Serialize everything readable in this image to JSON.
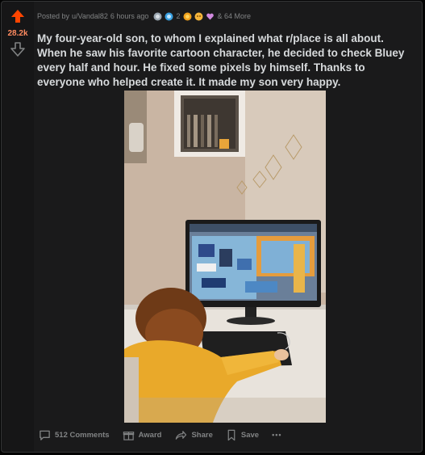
{
  "post": {
    "score": "28.2k",
    "posted_by_prefix": "Posted by",
    "author": "u/Vandal82",
    "time": "6 hours ago",
    "award_count": "2",
    "more_awards": "& 64 More",
    "title": "My four-year-old son, to whom I explained what r/place is all about. When he saw his favorite cartoon character, he decided to check Bluey every half and hour. He fixed some pixels by himself. Thanks to everyone who helped create it. It made my son very happy."
  },
  "actions": {
    "comments": "512 Comments",
    "award": "Award",
    "share": "Share",
    "save": "Save",
    "more": "•••"
  },
  "icons": {
    "upvote": "upvote-arrow-icon",
    "downvote": "downvote-arrow-icon",
    "comments": "comment-bubble-icon",
    "award": "gift-icon",
    "share": "share-arrow-icon",
    "save": "bookmark-icon",
    "more": "ellipsis-icon"
  },
  "colors": {
    "upvoted": "#ff4500",
    "score": "#ff8b60",
    "text": "#d7dadc",
    "muted": "#818384",
    "card_bg": "#1a1a1b"
  }
}
